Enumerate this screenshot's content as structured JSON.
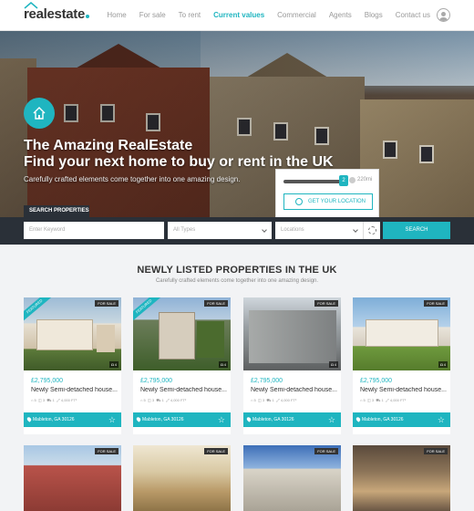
{
  "brand": {
    "name": "realestate",
    "accent": "#1fb5c0"
  },
  "nav": {
    "items": [
      "Home",
      "For sale",
      "To rent",
      "Current values",
      "Commercial",
      "Agents",
      "Blogs",
      "Contact us"
    ],
    "active": "Current values"
  },
  "hero": {
    "title_line1": "The Amazing RealEstate",
    "title_line2": "Find your next home to buy or rent in the UK",
    "subtitle": "Carefully crafted elements come together into one amazing design."
  },
  "radius": {
    "handle_value": "2",
    "value_label": "220mi",
    "fill_fraction": 0.85,
    "location_button": "GET YOUR LOCATION"
  },
  "search": {
    "tab_label": "SEARCH PROPERTIES",
    "keyword_placeholder": "Enter Keyword",
    "type_value": "All Types",
    "location_value": "Locations",
    "button_label": "SEARCH"
  },
  "section": {
    "title": "NEWLY LISTED PROPERTIES IN THE UK",
    "subtitle": "Carefully crafted elements come together into one amazing design."
  },
  "cards": [
    {
      "badge": "FOR SALE",
      "ribbon": "FEATURED",
      "photos": "4",
      "price": "£2,795,000",
      "title": "Newly Semi-detached house...",
      "beds": "5",
      "baths": "3",
      "cars": "1",
      "area": "4,000 FT²",
      "location": "Mableton, GA 30126"
    },
    {
      "badge": "FOR SALE",
      "ribbon": "FEATURED",
      "photos": "4",
      "price": "£2,795,000",
      "title": "Newly Semi-detached house...",
      "beds": "5",
      "baths": "3",
      "cars": "1",
      "area": "4,000 FT²",
      "location": "Mableton, GA 30126"
    },
    {
      "badge": "FOR SALE",
      "ribbon": "",
      "photos": "4",
      "price": "£2,795,000",
      "title": "Newly Semi-detached house...",
      "beds": "5",
      "baths": "3",
      "cars": "1",
      "area": "4,000 FT²",
      "location": "Mableton, GA 30126"
    },
    {
      "badge": "FOR SALE",
      "ribbon": "",
      "photos": "4",
      "price": "£2,795,000",
      "title": "Newly Semi-detached house...",
      "beds": "5",
      "baths": "3",
      "cars": "1",
      "area": "4,000 FT²",
      "location": "Mableton, GA 30126"
    },
    {
      "badge": "FOR SALE",
      "ribbon": ""
    },
    {
      "badge": "FOR SALE",
      "ribbon": ""
    },
    {
      "badge": "FOR SALE",
      "ribbon": ""
    },
    {
      "badge": "FOR SALE",
      "ribbon": ""
    }
  ]
}
